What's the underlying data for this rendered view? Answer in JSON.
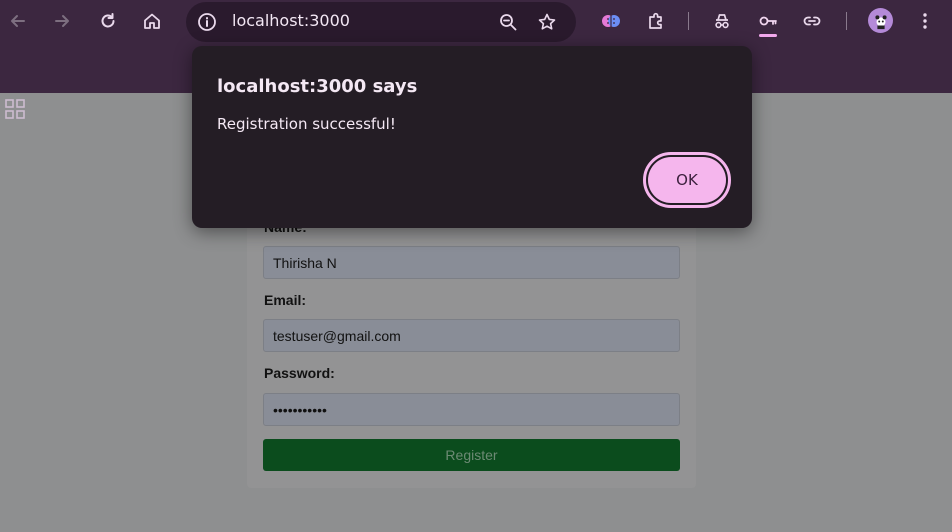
{
  "browser": {
    "url": "localhost:3000",
    "toolbar_icons": [
      "back-icon",
      "forward-icon",
      "reload-icon",
      "home-icon",
      "site-info-icon",
      "zoom-icon",
      "bookmark-star-icon",
      "gemini-brain-icon",
      "extensions-icon",
      "incognito-icon",
      "password-key-icon",
      "link-icon",
      "profile-avatar",
      "more-menu-icon"
    ],
    "bookmark_icons": [
      "apps-grid-icon"
    ]
  },
  "dialog": {
    "title": "localhost:3000 says",
    "message": "Registration successful!",
    "ok_label": "OK",
    "accent": "#f5b6ed"
  },
  "form": {
    "name_label": "Name:",
    "name_value": "Thirisha N",
    "email_label": "Email:",
    "email_value": "testuser@gmail.com",
    "password_label": "Password:",
    "password_value": "•••••••••••",
    "submit_label": "Register",
    "submit_color": "#0b4c1d"
  }
}
